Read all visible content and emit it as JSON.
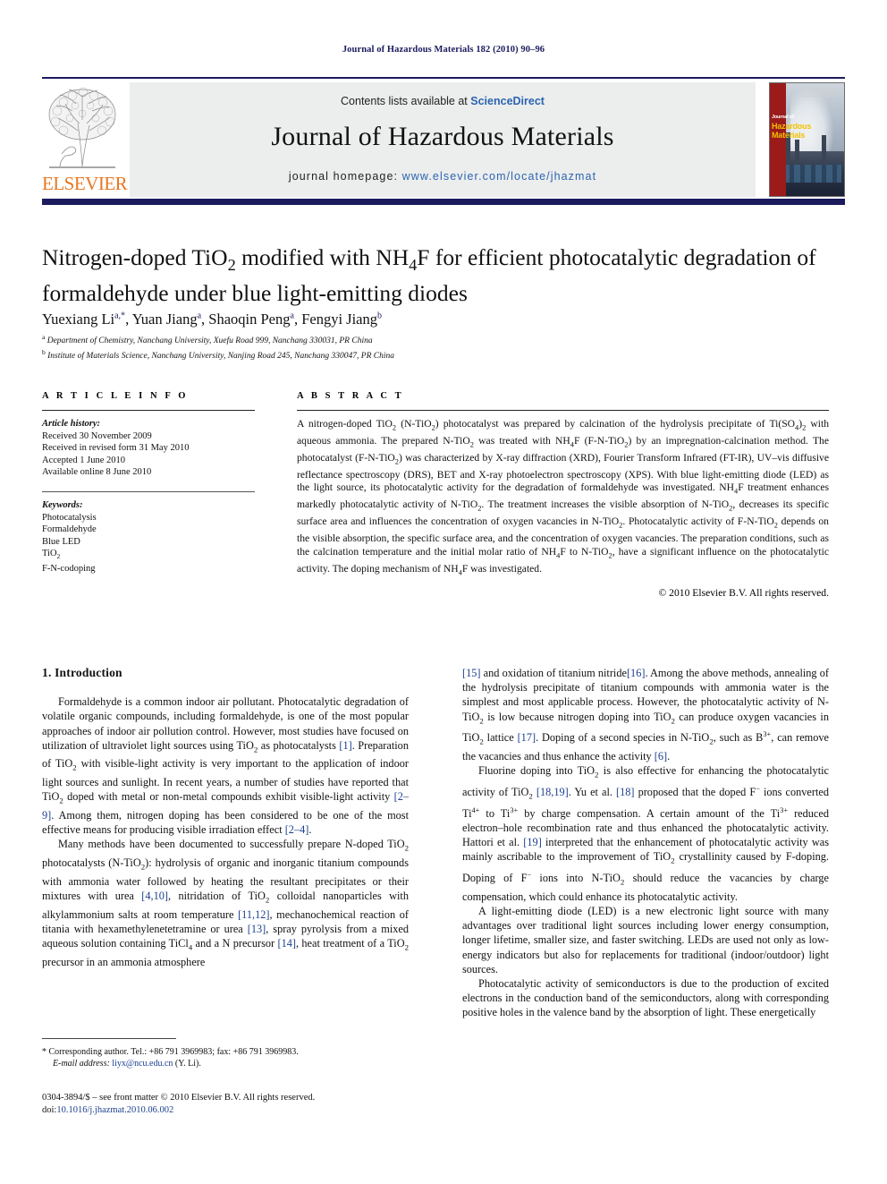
{
  "running_head": "Journal of Hazardous Materials 182 (2010) 90–96",
  "masthead": {
    "publisher": "ELSEVIER",
    "contents_prefix": "Contents lists available at",
    "contents_link": "ScienceDirect",
    "journal_title": "Journal of Hazardous Materials",
    "homepage_label": "journal homepage:",
    "homepage_url": "www.elsevier.com/locate/jhazmat",
    "cover_title_line1": "Journal of",
    "cover_title_line2": "Hazardous",
    "cover_title_line3": "Materials"
  },
  "article": {
    "title": "Nitrogen-doped TiO2 modified with NH4F for efficient photocatalytic degradation of formaldehyde under blue light-emitting diodes",
    "authors": "Yuexiang Li, Yuan Jiang, Shaoqin Peng, Fengyi Jiang",
    "affiliation_a": "Department of Chemistry, Nanchang University, Xuefu Road 999, Nanchang 330031, PR China",
    "affiliation_b": "Institute of Materials Science, Nanchang University, Nanjing Road 245, Nanchang 330047, PR China"
  },
  "article_info": {
    "heading": "A R T I C L E   I N F O",
    "history_label": "Article history:",
    "history": [
      "Received 30 November 2009",
      "Received in revised form 31 May 2010",
      "Accepted 1 June 2010",
      "Available online 8 June 2010"
    ],
    "keywords_label": "Keywords:",
    "keywords": [
      "Photocatalysis",
      "Formaldehyde",
      "Blue LED",
      "TiO2",
      "F-N-codoping"
    ]
  },
  "abstract": {
    "heading": "A B S T R A C T",
    "text": "A nitrogen-doped TiO2 (N-TiO2) photocatalyst was prepared by calcination of the hydrolysis precipitate of Ti(SO4)2 with aqueous ammonia. The prepared N-TiO2 was treated with NH4F (F-N-TiO2) by an impregnation-calcination method. The photocatalyst (F-N-TiO2) was characterized by X-ray diffraction (XRD), Fourier Transform Infrared (FT-IR), UV–vis diffusive reflectance spectroscopy (DRS), BET and X-ray photoelectron spectroscopy (XPS). With blue light-emitting diode (LED) as the light source, its photocatalytic activity for the degradation of formaldehyde was investigated. NH4F treatment enhances markedly photocatalytic activity of N-TiO2. The treatment increases the visible absorption of N-TiO2, decreases its specific surface area and influences the concentration of oxygen vacancies in N-TiO2. Photocatalytic activity of F-N-TiO2 depends on the visible absorption, the specific surface area, and the concentration of oxygen vacancies. The preparation conditions, such as the calcination temperature and the initial molar ratio of NH4F to N-TiO2, have a significant influence on the photocatalytic activity. The doping mechanism of NH4F was investigated.",
    "copyright": "© 2010 Elsevier B.V. All rights reserved."
  },
  "body": {
    "section_heading": "1.  Introduction",
    "left_paragraphs": [
      "Formaldehyde is a common indoor air pollutant. Photocatalytic degradation of volatile organic compounds, including formaldehyde, is one of the most popular approaches of indoor air pollution control. However, most studies have focused on utilization of ultraviolet light sources using TiO2 as photocatalysts [1]. Preparation of TiO2 with visible-light activity is very important to the application of indoor light sources and sunlight. In recent years, a number of studies have reported that TiO2 doped with metal or non-metal compounds exhibit visible-light activity [2–9]. Among them, nitrogen doping has been considered to be one of the most effective means for producing visible irradiation effect [2–4].",
      "Many methods have been documented to successfully prepare N-doped TiO2 photocatalysts (N-TiO2): hydrolysis of organic and inorganic titanium compounds with ammonia water followed by heating the resultant precipitates or their mixtures with urea [4,10], nitridation of TiO2 colloidal nanoparticles with alkylammonium salts at room temperature [11,12], mechanochemical reaction of titania with hexamethylenetetramine or urea [13], spray pyrolysis from a mixed aqueous solution containing TiCl4 and a N precursor [14], heat treatment of a TiO2 precursor in an ammonia atmosphere"
    ],
    "right_paragraphs": [
      "[15] and oxidation of titanium nitride[16]. Among the above methods, annealing of the hydrolysis precipitate of titanium compounds with ammonia water is the simplest and most applicable process. However, the photocatalytic activity of N-TiO2 is low because nitrogen doping into TiO2 can produce oxygen vacancies in TiO2 lattice [17]. Doping of a second species in N-TiO2, such as B3+, can remove the vacancies and thus enhance the activity [6].",
      "Fluorine doping into TiO2 is also effective for enhancing the photocatalytic activity of TiO2 [18,19]. Yu et al. [18] proposed that the doped F− ions converted Ti4+ to Ti3+ by charge compensation. A certain amount of the Ti3+ reduced electron–hole recombination rate and thus enhanced the photocatalytic activity. Hattori et al. [19] interpreted that the enhancement of photocatalytic activity was mainly ascribable to the improvement of TiO2 crystallinity caused by F-doping. Doping of F− ions into N-TiO2 should reduce the vacancies by charge compensation, which could enhance its photocatalytic activity.",
      "A light-emitting diode (LED) is a new electronic light source with many advantages over traditional light sources including lower energy consumption, longer lifetime, smaller size, and faster switching. LEDs are used not only as low-energy indicators but also for replacements for traditional (indoor/outdoor) light sources.",
      "Photocatalytic activity of semiconductors is due to the production of excited electrons in the conduction band of the semiconductors, along with corresponding positive holes in the valence band by the absorption of light. These energetically"
    ]
  },
  "footnotes": {
    "corresponding": "* Corresponding author. Tel.: +86 791 3969983; fax: +86 791 3969983.",
    "email_label": "E-mail address:",
    "email": "liyx@ncu.edu.cn",
    "email_suffix": "(Y. Li).",
    "issn_line": "0304-3894/$ – see front matter © 2010 Elsevier B.V. All rights reserved.",
    "doi_label": "doi:",
    "doi": "10.1016/j.jhazmat.2010.06.002"
  },
  "colors": {
    "navy": "#1b1b5e",
    "link_blue": "#2b65b0",
    "ref_blue": "#1b3f8f",
    "elsevier_orange": "#e87722",
    "banner_gray": "#eceded"
  }
}
